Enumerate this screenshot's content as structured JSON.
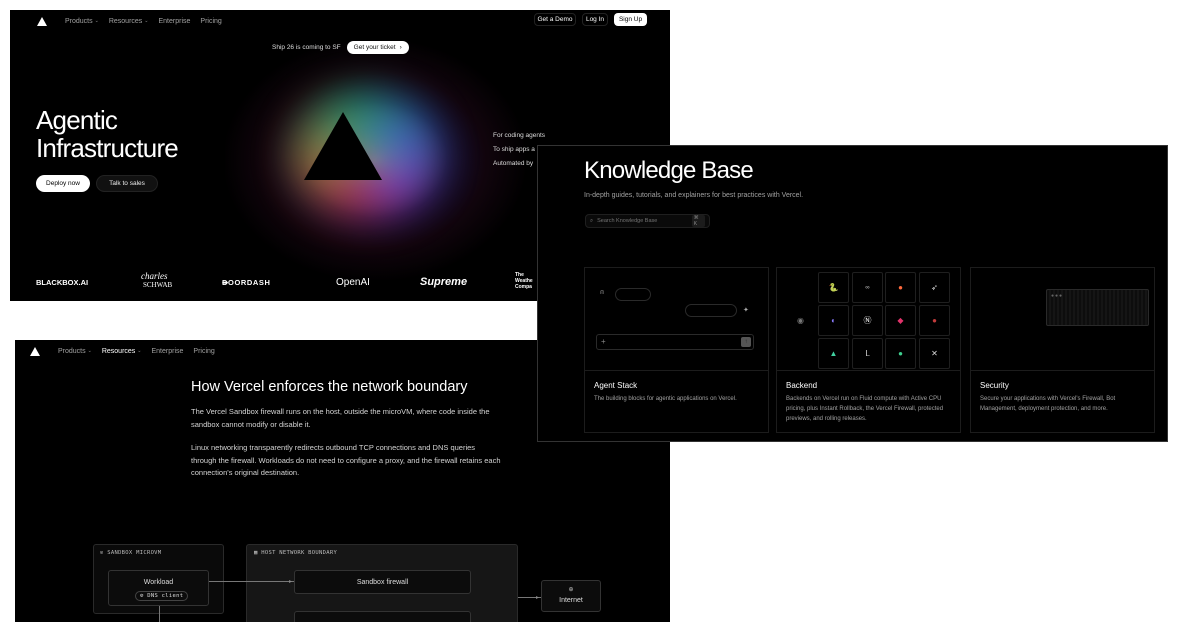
{
  "panel1": {
    "nav": {
      "items": [
        {
          "label": "Products",
          "chevron": true
        },
        {
          "label": "Resources",
          "chevron": true
        },
        {
          "label": "Enterprise",
          "chevron": false
        },
        {
          "label": "Pricing",
          "chevron": false
        }
      ],
      "get_demo": "Get a Demo",
      "login": "Log In",
      "signup": "Sign Up"
    },
    "announcement": {
      "text": "Ship 26 is coming to SF",
      "cta": "Get your ticket",
      "cta_arrow": "›"
    },
    "hero": {
      "line1": "Agentic",
      "line2": "Infrastructure"
    },
    "buttons": {
      "deploy": "Deploy now",
      "sales": "Talk to sales"
    },
    "side_links": [
      "For coding agents",
      "To ship apps a",
      "Automated by"
    ],
    "logos": [
      "BLACKBOX.AI",
      "charles",
      "SCHWAB",
      "DOORDASH",
      "OpenAI",
      "Supreme",
      "The",
      "Weathe",
      "Compa"
    ]
  },
  "panel2": {
    "nav": {
      "items": [
        {
          "label": "Products",
          "chevron": true
        },
        {
          "label": "Resources",
          "chevron": true
        },
        {
          "label": "Enterprise",
          "chevron": false
        },
        {
          "label": "Pricing",
          "chevron": false
        }
      ]
    },
    "heading": "How Vercel enforces the network boundary",
    "para1": "The Vercel Sandbox firewall runs on the host, outside the microVM, where code inside the sandbox cannot modify or disable it.",
    "para2": "Linux networking transparently redirects outbound TCP connections and DNS queries through the firewall. Workloads do not need to configure a proxy, and the firewall retains each connection's original destination.",
    "diagram": {
      "sandbox_label": "SANDBOX MICROVM",
      "host_label": "HOST NETWORK BOUNDARY",
      "workload": "Workload",
      "dns_client": "DNS client",
      "firewall": "Sandbox firewall",
      "internet": "Internet"
    }
  },
  "panel3": {
    "title": "Knowledge Base",
    "subtitle": "In-depth guides, tutorials, and explainers for best practices with Vercel.",
    "search_placeholder": "Search Knowledge Base",
    "search_kbd": "⌘ K",
    "cards": [
      {
        "title": "Agent Stack",
        "desc": "The building blocks for agentic applications on Vercel."
      },
      {
        "title": "Backend",
        "desc": "Backends on Vercel run on Fluid compute with Active CPU pricing, plus Instant Rollback, the Vercel Firewall, protected previews, and rolling releases."
      },
      {
        "title": "Security",
        "desc": "Secure your applications with Vercel's Firewall, Bot Management, deployment protection, and more."
      }
    ],
    "agent_stack_send": "↑"
  },
  "colors": {
    "background": "#000000",
    "text": "#ededed",
    "muted": "#a1a1a1",
    "border": "#1c1c1c"
  }
}
